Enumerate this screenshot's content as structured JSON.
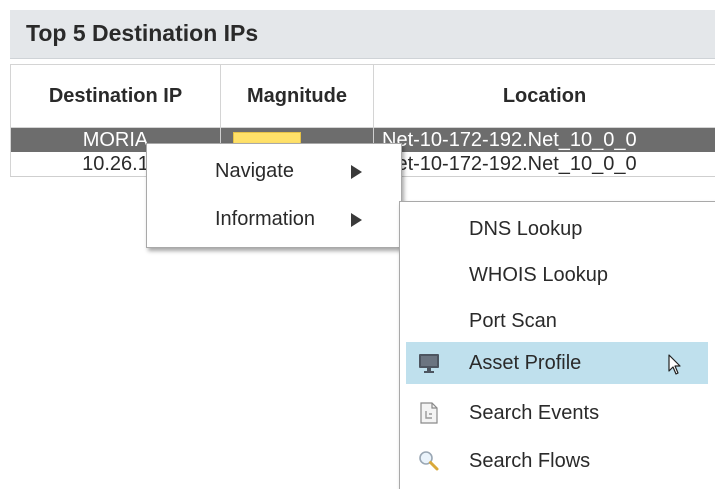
{
  "panel": {
    "title": "Top 5 Destination IPs"
  },
  "table": {
    "headers": {
      "ip": "Destination IP",
      "magnitude": "Magnitude",
      "location": "Location"
    },
    "rows": [
      {
        "ip": "MORIA",
        "magnitude": 0.8,
        "location": "Net-10-172-192.Net_10_0_0",
        "selected": true
      },
      {
        "ip": "10.26.1",
        "magnitude": null,
        "location": "Net-10-172-192.Net_10_0_0",
        "selected": false
      }
    ]
  },
  "context_menu": {
    "items": [
      {
        "label": "Navigate",
        "has_submenu": true
      },
      {
        "label": "Information",
        "has_submenu": true
      }
    ]
  },
  "submenu": {
    "items": [
      {
        "label": "DNS Lookup",
        "icon": ""
      },
      {
        "label": "WHOIS Lookup",
        "icon": ""
      },
      {
        "label": "Port Scan",
        "icon": ""
      },
      {
        "label": "Asset Profile",
        "icon": "monitor-icon",
        "hovered": true
      },
      {
        "label": "Search Events",
        "icon": "document-icon"
      },
      {
        "label": "Search Flows",
        "icon": "magnifier-icon"
      }
    ]
  },
  "colors": {
    "selected_row": "#6d6d6d",
    "hover_highlight": "#bfe0ed",
    "magnitude_bar": "#ffe169",
    "header_bg": "#e4e7ea"
  }
}
